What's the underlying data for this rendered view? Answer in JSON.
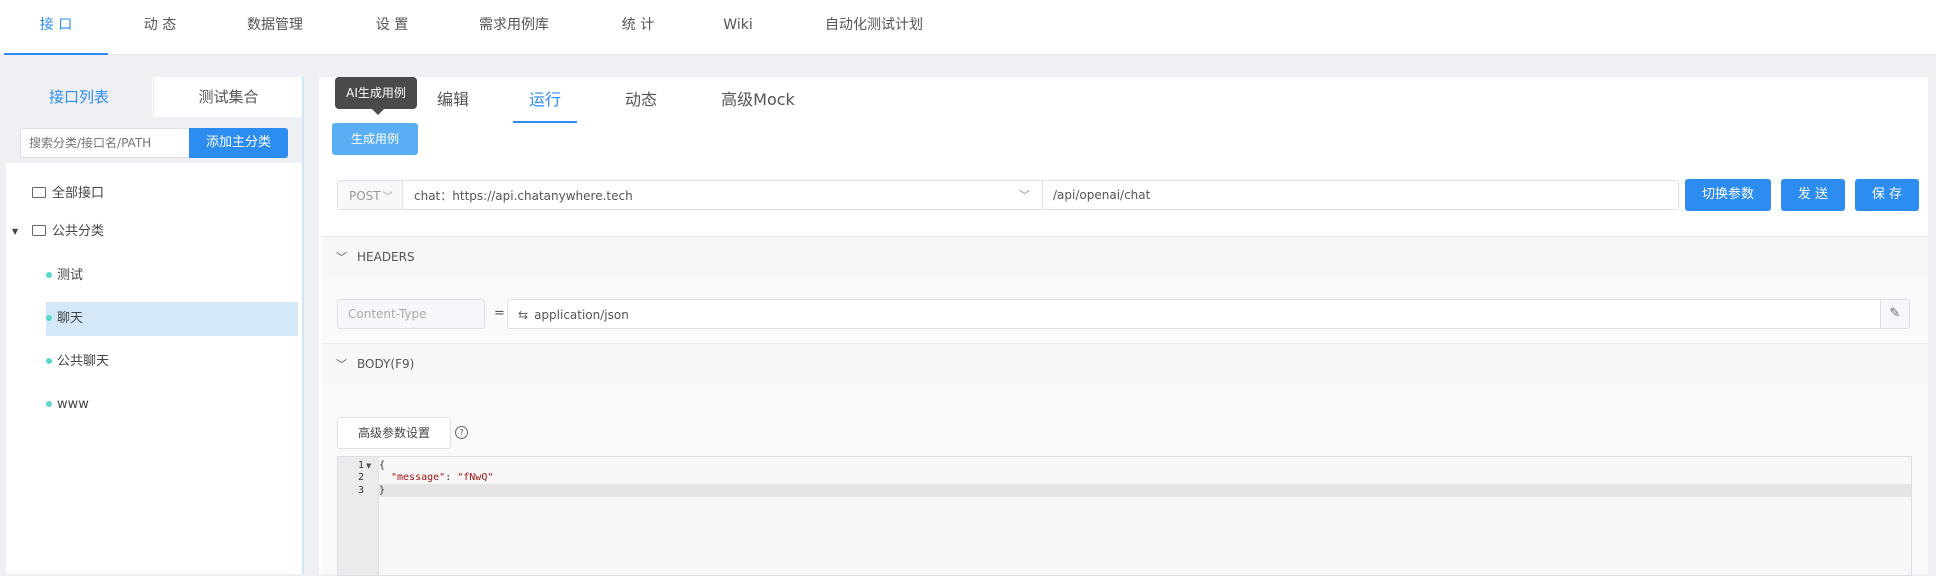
{
  "topnav": {
    "tabs": [
      {
        "label": "接 口"
      },
      {
        "label": "动 态"
      },
      {
        "label": "数据管理"
      },
      {
        "label": "设 置"
      },
      {
        "label": "需求用例库"
      },
      {
        "label": "统 计"
      },
      {
        "label": "Wiki"
      },
      {
        "label": "自动化测试计划"
      }
    ],
    "active_index": 0
  },
  "sidebar": {
    "tabs": [
      {
        "label": "接口列表"
      },
      {
        "label": "测试集合"
      }
    ],
    "search_placeholder": "搜索分类/接口名/PATH",
    "add_button": "添加主分类",
    "all_label": "全部接口",
    "group_label": "公共分类",
    "items": [
      {
        "label": "测试"
      },
      {
        "label": "聊天",
        "selected": true
      },
      {
        "label": "公共聊天"
      },
      {
        "label": "www"
      }
    ]
  },
  "main": {
    "tooltip": "AI生成用例",
    "tabs": [
      {
        "label": "编辑"
      },
      {
        "label": "运行"
      },
      {
        "label": "动态"
      },
      {
        "label": "高级Mock"
      }
    ],
    "active_tab": "运行",
    "generate_button": "生成用例",
    "method": "POST",
    "host": "chat：https://api.chatanywhere.tech",
    "path": "/api/openai/chat",
    "buttons": {
      "switch": "切换参数",
      "send": "发 送",
      "save": "保 存"
    },
    "headers": {
      "title": "HEADERS",
      "key": "Content-Type",
      "value": "application/json"
    },
    "body": {
      "title": "BODY(F9)",
      "advanced": "高级参数设置",
      "lines": [
        {
          "num": "1",
          "text": "{"
        },
        {
          "num": "2",
          "key": "\"message\"",
          "sep": ": ",
          "val": "\"fNwQ\""
        },
        {
          "num": "3",
          "text": "}"
        }
      ]
    }
  },
  "colors": {
    "accent": "#2d8cf0",
    "selected_bg": "#d5e8f8",
    "dot": "#5ad8c8"
  }
}
